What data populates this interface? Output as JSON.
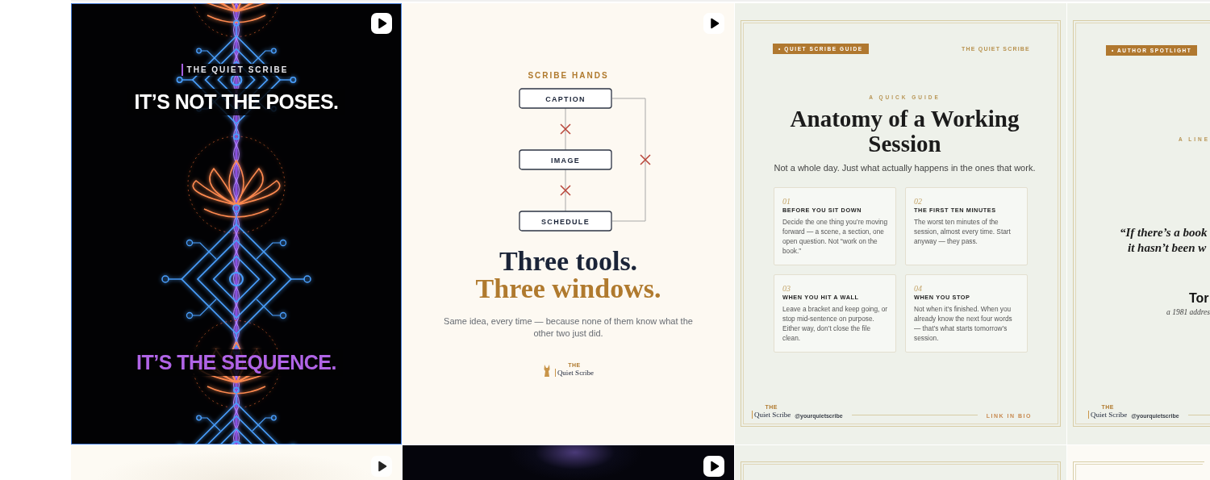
{
  "grid": [
    {
      "kind": "reel",
      "selected": true,
      "video": true,
      "eyebrow": "THE QUIET SCRIBE",
      "headline": "IT’S NOT THE POSES.",
      "closing": "IT’S THE SEQUENCE."
    },
    {
      "kind": "diagram",
      "selected": false,
      "video": true,
      "eyebrow": "SCRIBE HANDS",
      "nodes": [
        "CAPTION",
        "IMAGE",
        "SCHEDULE"
      ],
      "links": [
        {
          "crossed": true
        },
        {
          "crossed": true
        },
        {
          "crossed": true
        }
      ],
      "title": "Three tools.",
      "title_accent": "Three windows.",
      "body": "Same idea, every time — because none of them know what the other two just did.",
      "logo": {
        "small": "THE",
        "name": "Quiet Scribe"
      }
    },
    {
      "kind": "guide",
      "selected": false,
      "video": false,
      "tag": "• QUIET SCRIBE GUIDE",
      "brand": "THE QUIET SCRIBE",
      "eyebrow": "A QUICK GUIDE",
      "title": "Anatomy of a Working Session",
      "subtitle": "Not a whole day. Just what actually happens in the ones that work.",
      "cards": [
        {
          "number": "01",
          "heading": "BEFORE YOU SIT DOWN",
          "body": "Decide the one thing you’re moving forward — a scene, a section, one open question. Not “work on the book.”"
        },
        {
          "number": "02",
          "heading": "THE FIRST TEN MINUTES",
          "body": "The worst ten minutes of the session, almost every time. Start anyway — they pass."
        },
        {
          "number": "03",
          "heading": "WHEN YOU HIT A WALL",
          "body": "Leave a bracket and keep going, or stop mid-sentence on purpose. Either way, don’t close the file clean."
        },
        {
          "number": "04",
          "heading": "WHEN YOU STOP",
          "body": "Not when it’s finished. When you already know the next four words — that’s what starts tomorrow’s session."
        }
      ],
      "logo": {
        "small": "THE",
        "name": "Quiet Scribe"
      },
      "handle": "@yourquietscribe",
      "link": "LINK IN BIO"
    },
    {
      "kind": "spotlight",
      "selected": false,
      "video": false,
      "tag": "• AUTHOR SPOTLIGHT",
      "eyebrow": "A LINE",
      "quote": [
        "“If there’s a book",
        "it hasn’t been w"
      ],
      "author": "Tor",
      "source": "a 1981 addres",
      "logo": {
        "small": "THE",
        "name": "Quiet Scribe"
      },
      "handle": "@yourquietscribe"
    },
    {
      "kind": "light-preview",
      "selected": false,
      "video": true
    },
    {
      "kind": "dark-preview",
      "selected": false,
      "video": true
    },
    {
      "kind": "sage-preview",
      "selected": false,
      "video": false
    },
    {
      "kind": "cream-preview",
      "selected": false,
      "video": false
    }
  ]
}
